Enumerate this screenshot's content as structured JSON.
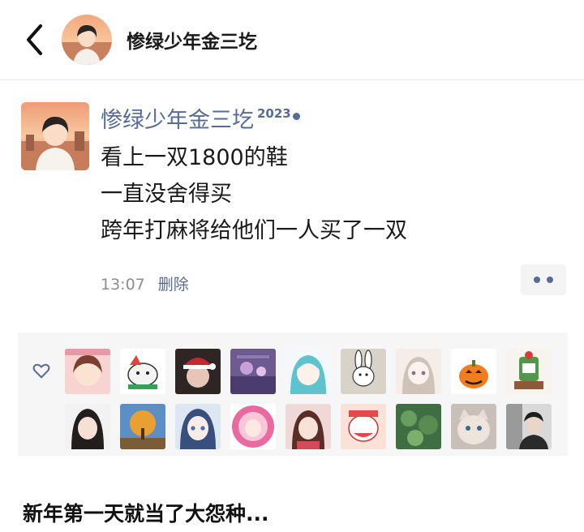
{
  "header": {
    "back_icon": "back-arrow-icon",
    "name": "惨绿少年金三圪"
  },
  "post": {
    "name": "惨绿少年金三圪",
    "name_superscript": "2023",
    "lines": [
      "看上一双1800的鞋",
      "一直没舍得买",
      "跨年打麻将给他们一人买了一双"
    ],
    "time": "13:07",
    "delete_label": "删除",
    "more_icon": "more-dots-icon"
  },
  "likes": {
    "icon": "heart-icon",
    "avatars": [
      "anime-girl-avatar",
      "cartoon-dog-avatar",
      "christmas-girl-avatar",
      "purple-scene-avatar",
      "teal-hair-anime-avatar",
      "bunny-doodle-avatar",
      "pastel-anime-avatar",
      "pumpkin-avatar",
      "cactus-sign-avatar",
      "girl-portrait-avatar",
      "autumn-tree-avatar",
      "blue-anime-avatar",
      "pink-circle-avatar",
      "girl-selfie-avatar",
      "cartoon-face-avatar",
      "green-leaves-avatar",
      "cat-face-avatar",
      "man-portrait-avatar"
    ]
  },
  "caption": "新年第一天就当了大怨种..."
}
